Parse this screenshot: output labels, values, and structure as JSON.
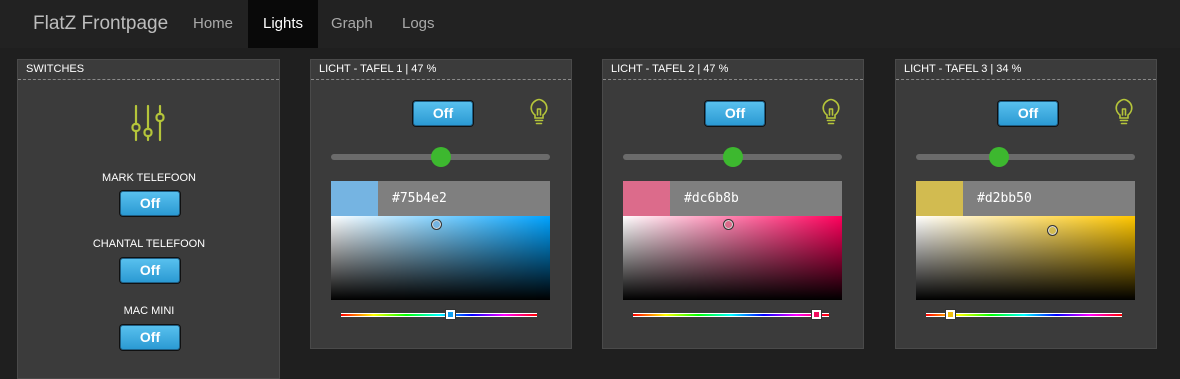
{
  "nav": {
    "brand": "FlatZ Frontpage",
    "items": [
      {
        "label": "Home",
        "active": false
      },
      {
        "label": "Lights",
        "active": true
      },
      {
        "label": "Graph",
        "active": false
      },
      {
        "label": "Logs",
        "active": false
      }
    ]
  },
  "switches": {
    "title": "SWITCHES",
    "icon": "sliders-icon",
    "icon_color": "#b5c53a",
    "items": [
      {
        "label": "MARK TELEFOON",
        "button": "Off"
      },
      {
        "label": "CHANTAL TELEFOON",
        "button": "Off"
      },
      {
        "label": "MAC MINI",
        "button": "Off"
      }
    ]
  },
  "lights": [
    {
      "title": "LICHT - TAFEL 1 | 47 %",
      "button": "Off",
      "icon": "lightbulb-icon",
      "level": 0.5,
      "hex": "#75b4e2",
      "hue": 0.56,
      "sv": [
        0.48,
        0.1
      ]
    },
    {
      "title": "LICHT - TAFEL 2 | 47 %",
      "button": "Off",
      "icon": "lightbulb-icon",
      "level": 0.5,
      "hex": "#dc6b8b",
      "hue": 0.94,
      "sv": [
        0.48,
        0.1
      ]
    },
    {
      "title": "LICHT - TAFEL 3 | 34 %",
      "button": "Off",
      "icon": "lightbulb-icon",
      "level": 0.38,
      "hex": "#d2bb50",
      "hue": 0.13,
      "sv": [
        0.62,
        0.17
      ]
    }
  ],
  "colors": {
    "accent": "#3db82f",
    "button": "#3aa9df",
    "panel": "#3b3b3b"
  }
}
